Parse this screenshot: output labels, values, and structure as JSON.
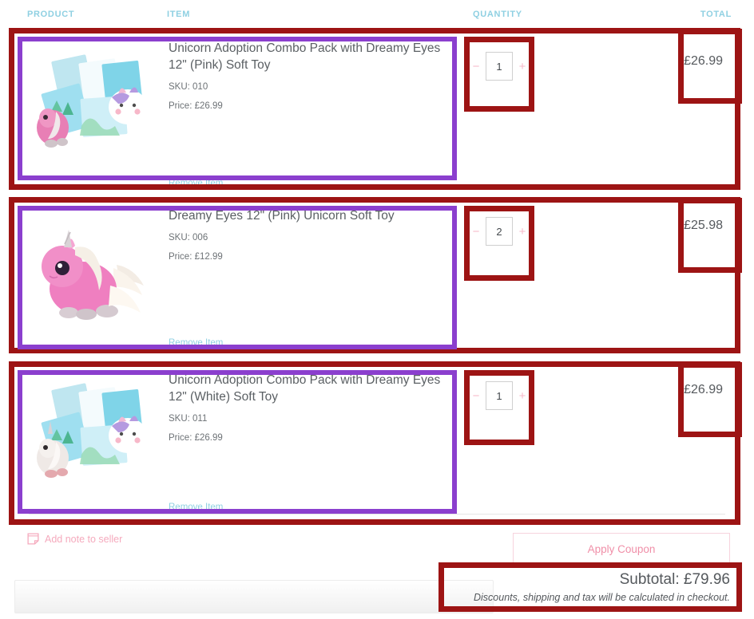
{
  "table": {
    "headers": {
      "product": "PRODUCT",
      "item": "ITEM",
      "quantity": "QUANTITY",
      "total": "TOTAL"
    }
  },
  "rows": [
    {
      "title": "Unicorn Adoption Combo Pack with Dreamy Eyes 12\" (Pink) Soft Toy",
      "sku": "SKU: 010",
      "price": "Price: £26.99",
      "remove": "Remove Item",
      "qty": "1",
      "minus": "−",
      "plus": "+",
      "total": "£26.99",
      "image": "unicorn-adoption-combo-pink-thumbnail"
    },
    {
      "title": "Dreamy Eyes 12\" (Pink) Unicorn Soft Toy",
      "sku": "SKU: 006",
      "price": "Price: £12.99",
      "remove": "Remove Item",
      "qty": "2",
      "minus": "−",
      "plus": "+",
      "total": "£25.98",
      "image": "pink-unicorn-plush-thumbnail"
    },
    {
      "title": "Unicorn Adoption Combo Pack with Dreamy Eyes 12\" (White) Soft Toy",
      "sku": "SKU: 011",
      "price": "Price: £26.99",
      "remove": "Remove Item",
      "qty": "1",
      "minus": "−",
      "plus": "+",
      "total": "£26.99",
      "image": "unicorn-adoption-combo-white-thumbnail"
    }
  ],
  "footer": {
    "note_label": "Add note to seller",
    "note_icon": "note-icon",
    "note_placeholder": "",
    "coupon_label": "Apply Coupon",
    "subtotal": "Subtotal: £79.96",
    "subtotal_note": "Discounts, shipping and tax will be calculated in checkout."
  },
  "colors": {
    "header_text": "#8fd0e2",
    "link": "#8fd0e2",
    "accent_pink": "#f5aabd",
    "annotation_red": "#9d1414",
    "annotation_purple": "#8b3fce",
    "text": "#55595d"
  }
}
